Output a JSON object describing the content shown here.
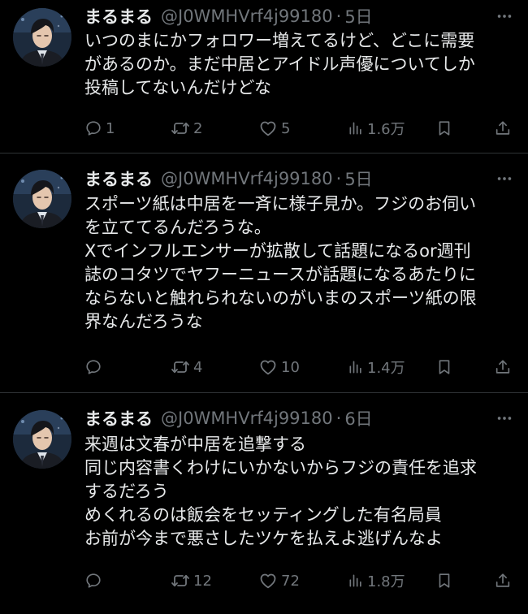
{
  "colors": {
    "background": "#000000",
    "text": "#e7e9ea",
    "secondary": "#71767b",
    "divider": "#2f3336"
  },
  "tweets": [
    {
      "name": "まるまる",
      "handle": "@J0WMHVrf4j99180",
      "separator": "·",
      "time": "5日",
      "text": "いつのまにかフォロワー増えてるけど、どこに需要\nがあるのか。まだ中居とアイドル声優についてしか\n投稿してないんだけどな",
      "replies": "1",
      "retweets": "2",
      "likes": "5",
      "views": "1.6万",
      "icons": [
        "reply-icon",
        "retweet-icon",
        "like-icon",
        "views-icon",
        "bookmark-icon",
        "share-icon",
        "more-icon"
      ]
    },
    {
      "name": "まるまる",
      "handle": "@J0WMHVrf4j99180",
      "separator": "·",
      "time": "5日",
      "text": "スポーツ紙は中居を一斉に様子見か。フジのお伺い\nを立ててるんだろうな。\nXでインフルエンサーが拡散して話題になるor週刊\n誌のコタツでヤフーニュースが話題になるあたりに\nならないと触れられないのがいまのスポーツ紙の限\n界なんだろうな",
      "replies": "",
      "retweets": "4",
      "likes": "10",
      "views": "1.4万",
      "icons": [
        "reply-icon",
        "retweet-icon",
        "like-icon",
        "views-icon",
        "bookmark-icon",
        "share-icon",
        "more-icon"
      ]
    },
    {
      "name": "まるまる",
      "handle": "@J0WMHVrf4j99180",
      "separator": "·",
      "time": "6日",
      "text": "来週は文春が中居を追撃する\n同じ内容書くわけにいかないからフジの責任を追求\nするだろう\nめくれるのは飯会をセッティングした有名局員\nお前が今まで悪さしたツケを払えよ逃げんなよ",
      "replies": "",
      "retweets": "12",
      "likes": "72",
      "views": "1.8万",
      "icons": [
        "reply-icon",
        "retweet-icon",
        "like-icon",
        "views-icon",
        "bookmark-icon",
        "share-icon",
        "more-icon"
      ]
    }
  ]
}
